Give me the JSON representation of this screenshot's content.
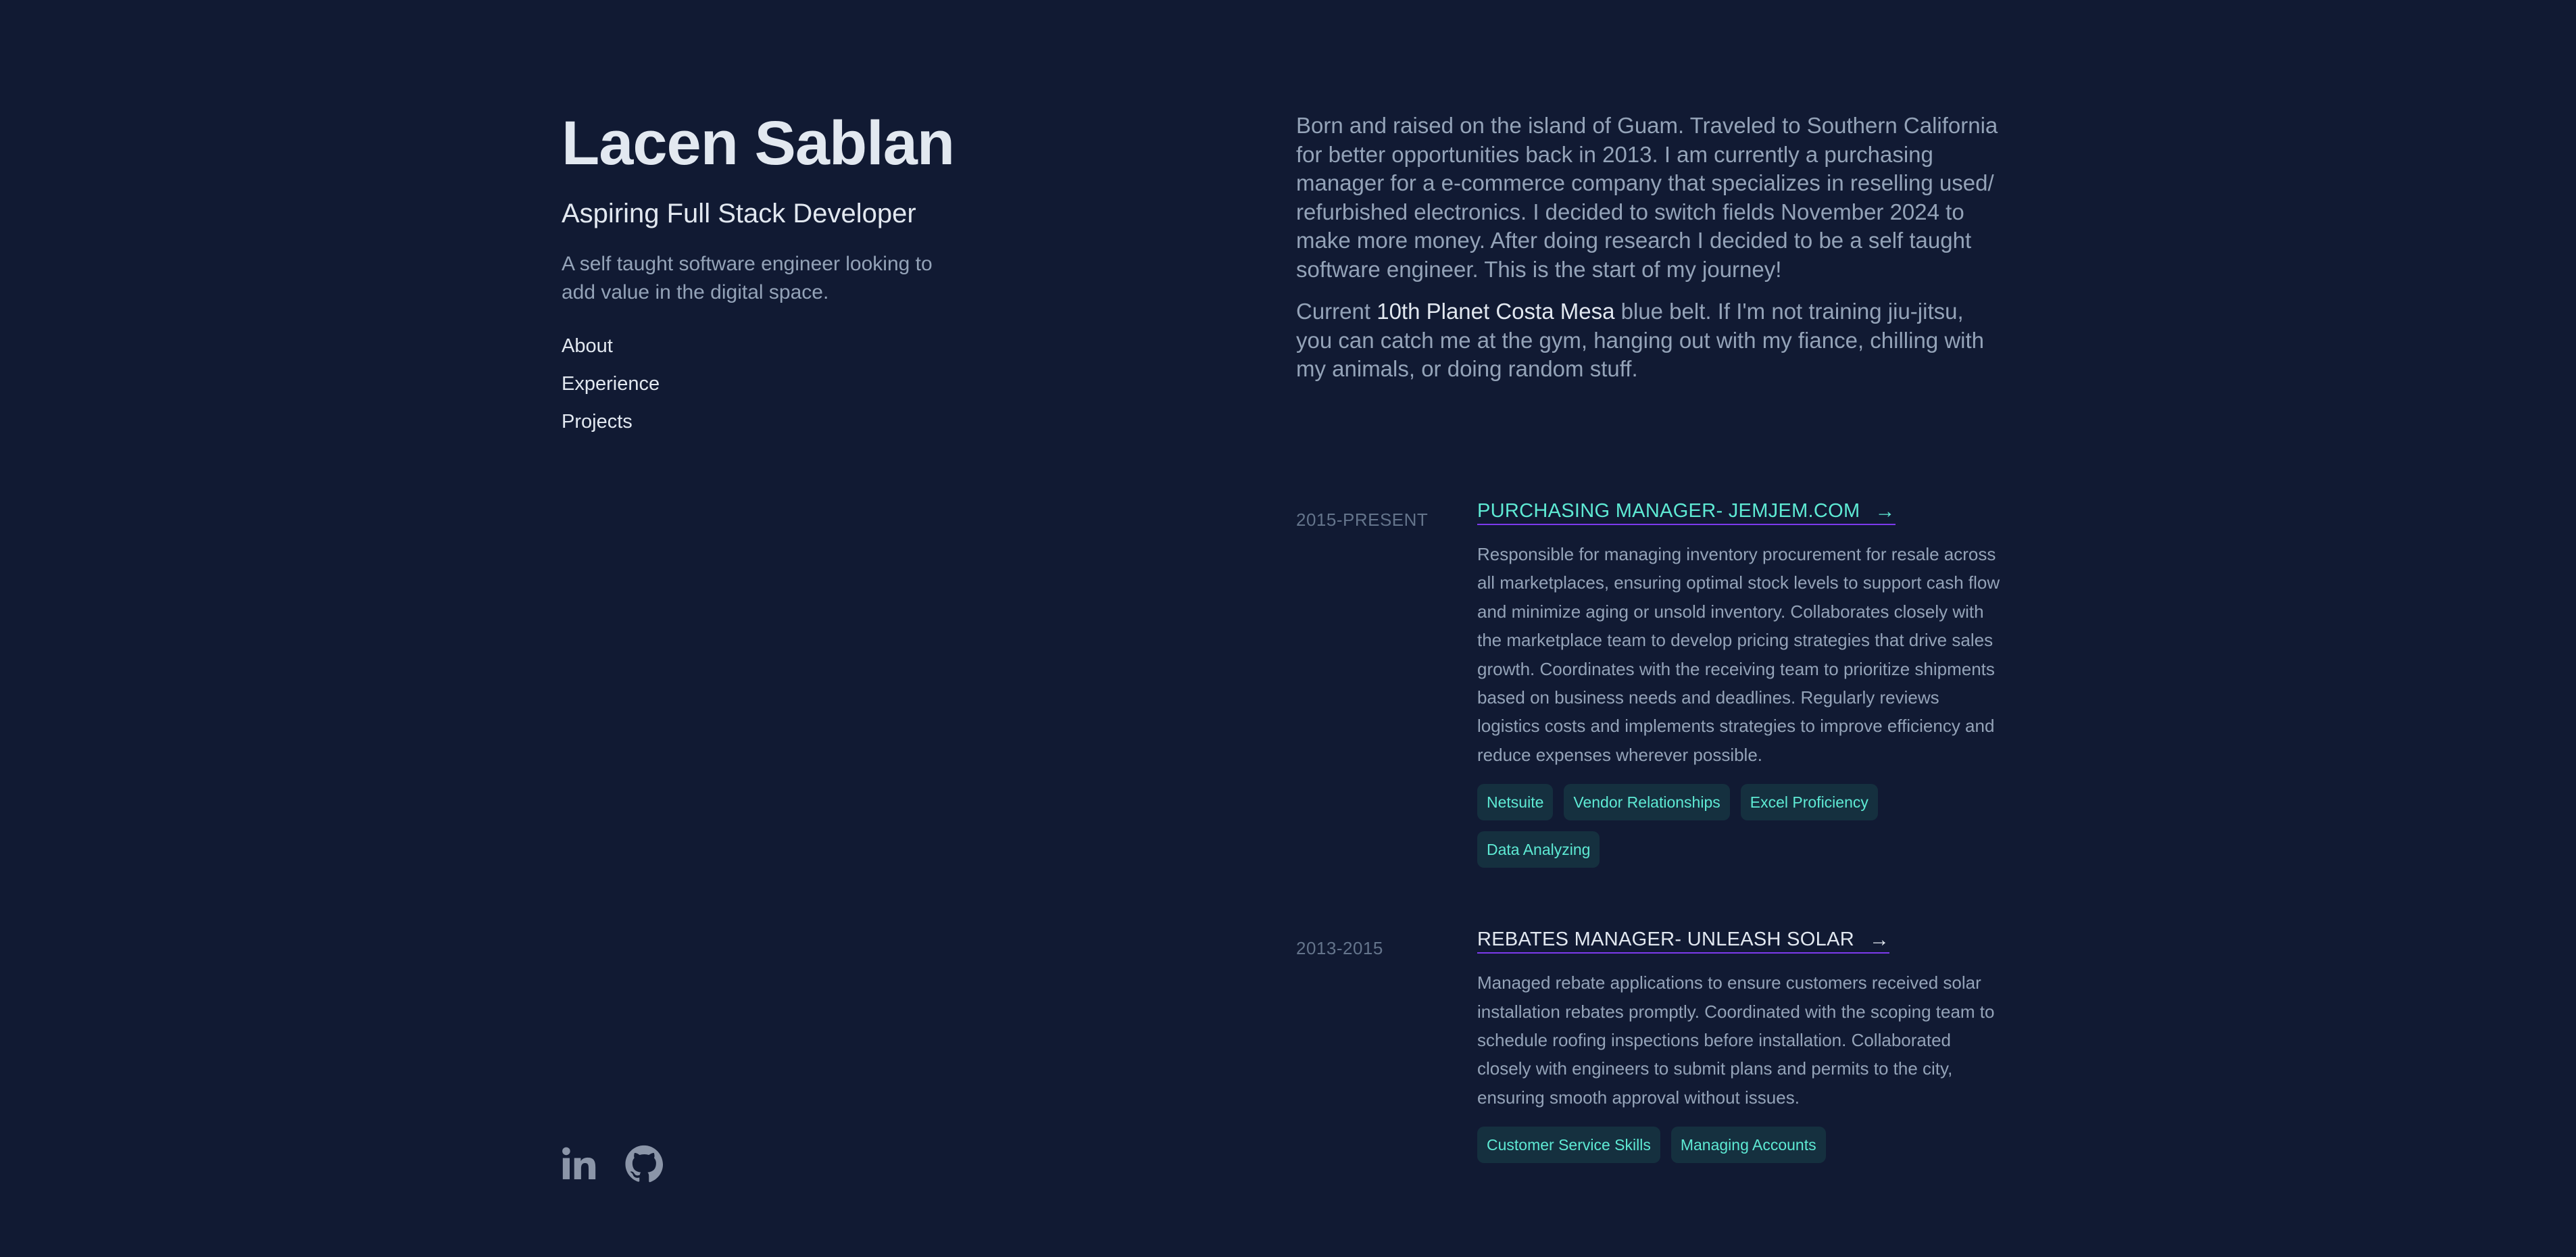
{
  "profile": {
    "name": "Lacen Sablan",
    "headline": "Aspiring Full Stack Developer",
    "tagline": "A self taught software engineer looking to add value in the digital space."
  },
  "nav": {
    "items": [
      {
        "label": "About"
      },
      {
        "label": "Experience"
      },
      {
        "label": "Projects"
      }
    ]
  },
  "socials": {
    "linkedin": "linkedin-icon",
    "github": "github-icon"
  },
  "about": {
    "paragraph1": "Born and raised on the island of Guam. Traveled to Southern California for better opportunities back in 2013. I am currently a purchasing manager for a e-commerce company that specializes in reselling used/ refurbished electronics. I decided to switch fields November 2024 to make more money. After doing research I decided to be a self taught software engineer. This is the start of my journey!",
    "p2_before": "Current ",
    "p2_highlight": "10th Planet Costa Mesa",
    "p2_after": " blue belt. If I'm not training jiu-jitsu, you can catch me at the gym, hanging out with my fiance, chilling with my animals, or doing random stuff."
  },
  "experience": [
    {
      "date": "2015-PRESENT",
      "title": "PURCHASING MANAGER- JEMJEM.COM",
      "description": "Responsible for managing inventory procurement for resale across all marketplaces, ensuring optimal stock levels to support cash flow and minimize aging or unsold inventory. Collaborates closely with the marketplace team to develop pricing strategies that drive sales growth. Coordinates with the receiving team to prioritize shipments based on business needs and deadlines. Regularly reviews logistics costs and implements strategies to improve efficiency and reduce expenses wherever possible.",
      "tags": [
        "Netsuite",
        "Vendor Relationships",
        "Excel Proficiency",
        "Data Analyzing"
      ]
    },
    {
      "date": "2013-2015",
      "title": "REBATES MANAGER- UNLEASH SOLAR",
      "description": "Managed rebate applications to ensure customers received solar installation rebates promptly. Coordinated with the scoping team to schedule roofing inspections before installation. Collaborated closely with engineers to submit plans and permits to the city, ensuring smooth approval without issues.",
      "tags": [
        "Customer Service Skills",
        "Managing Accounts"
      ]
    }
  ],
  "arrow_glyph": "→",
  "colors": {
    "background": "#111a33",
    "accent": "#5eead4",
    "text_primary": "#e2e8f0",
    "text_secondary": "#94a3b8"
  }
}
